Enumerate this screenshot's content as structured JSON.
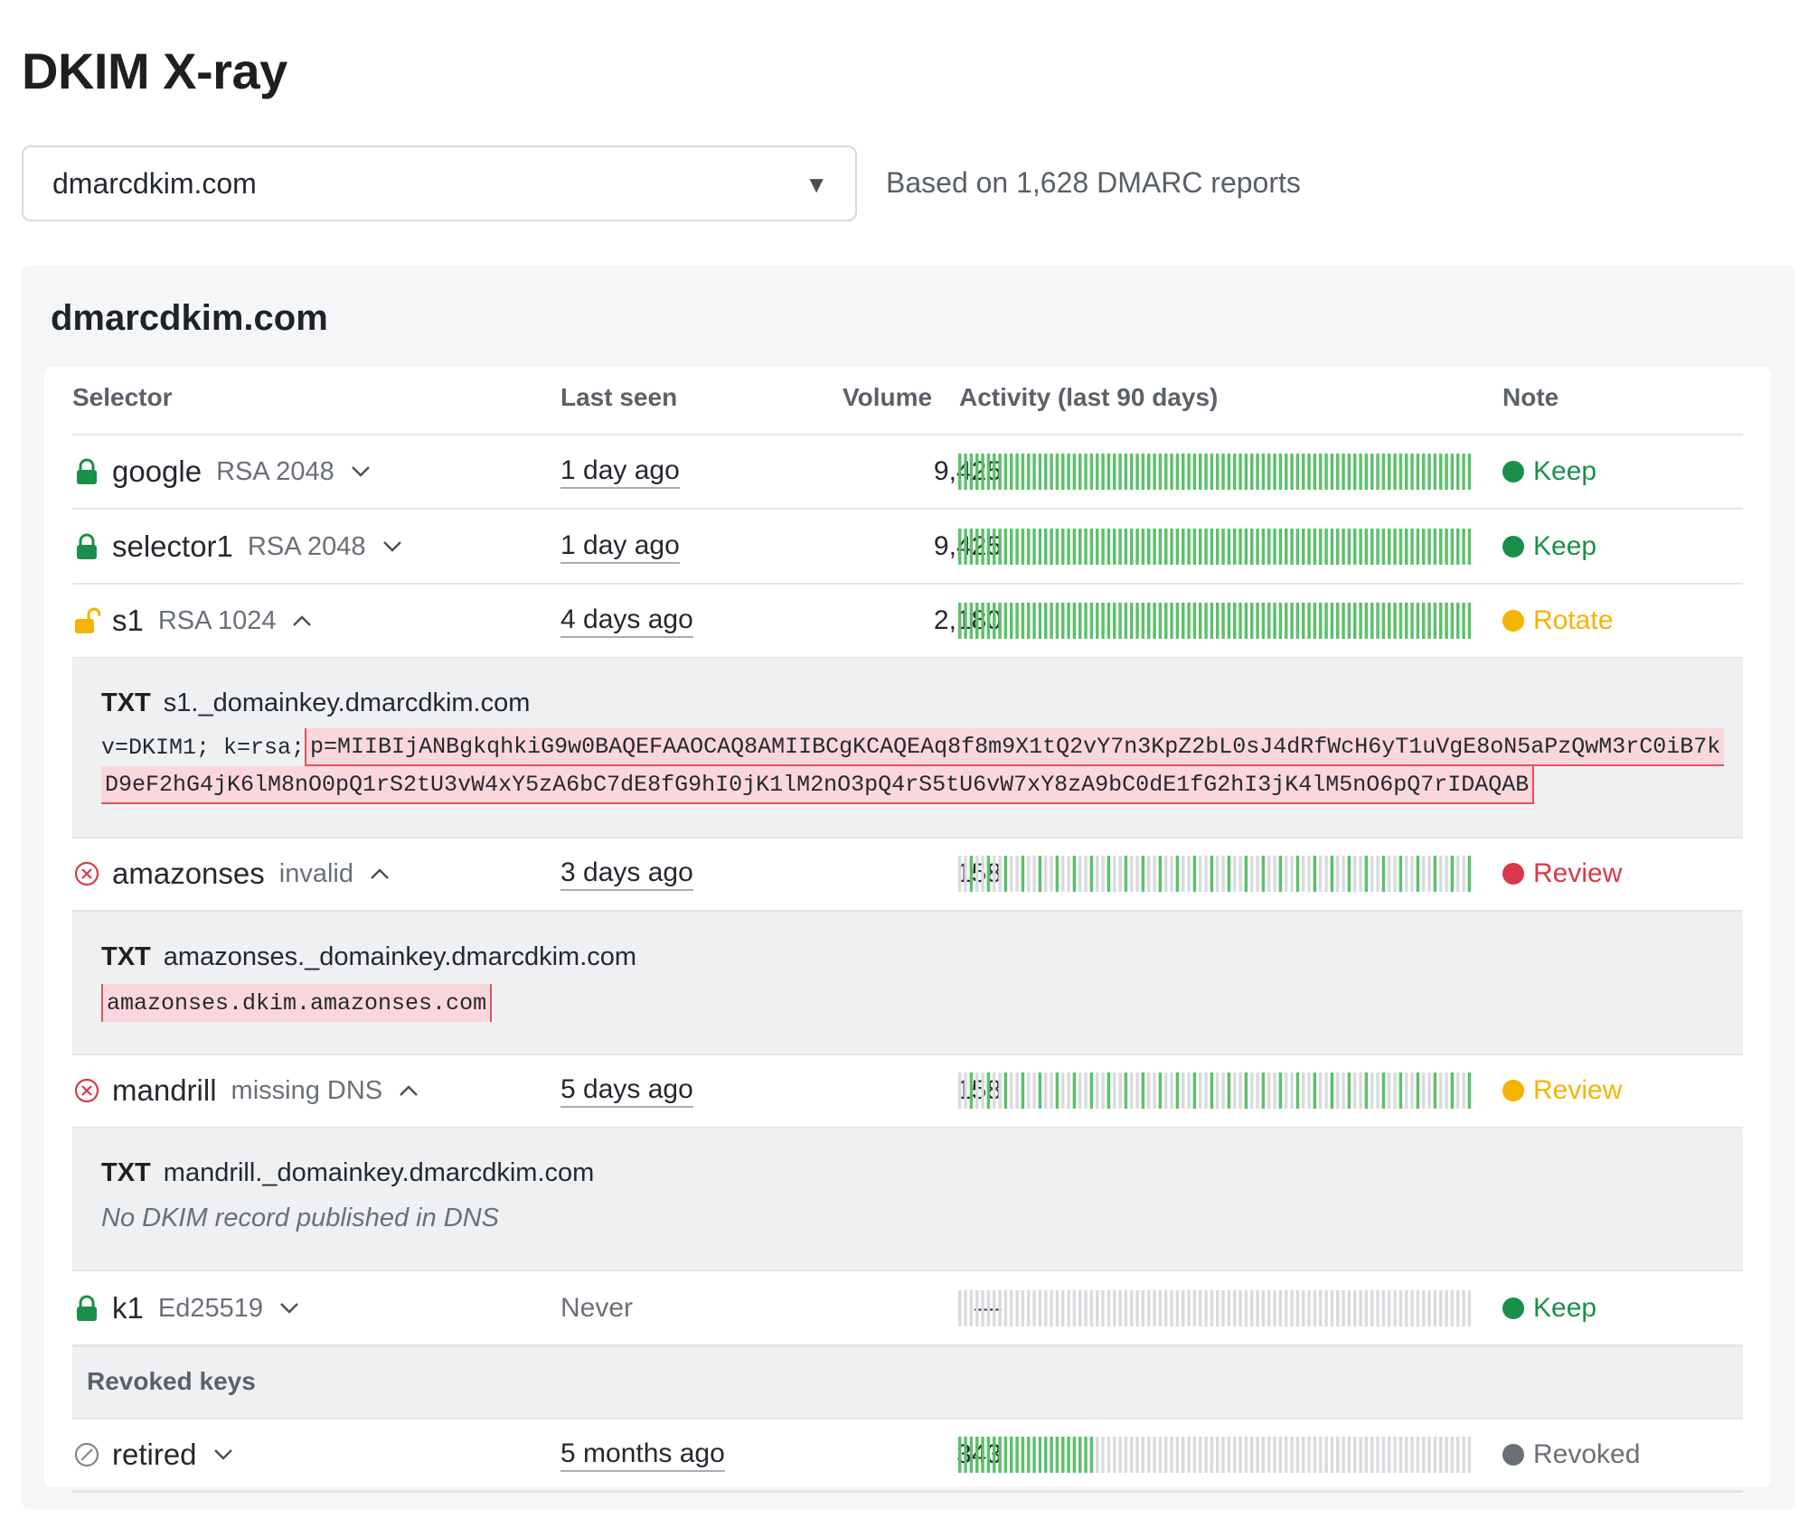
{
  "page": {
    "title": "DKIM X-ray"
  },
  "domain_select": {
    "value": "dmarcdkim.com",
    "caret": "▼"
  },
  "reports_info": "Based on 1,628 DMARC reports",
  "panel": {
    "title": "dmarcdkim.com",
    "columns": {
      "selector": "Selector",
      "last_seen": "Last seen",
      "volume": "Volume",
      "activity": "Activity (last 90 days)",
      "note": "Note"
    },
    "rows": [
      {
        "name": "google",
        "algo": "RSA 2048",
        "chevron": "down",
        "icon": "lock-icon",
        "last_seen": "1 day ago",
        "volume": "9,425",
        "note": "Keep",
        "note_color": "#1a8f4a",
        "activity": {
          "active_fraction": 1.0,
          "pattern": "solid"
        }
      },
      {
        "name": "selector1",
        "algo": "RSA 2048",
        "chevron": "down",
        "icon": "lock-icon",
        "last_seen": "1 day ago",
        "volume": "9,425",
        "note": "Keep",
        "note_color": "#1a8f4a",
        "activity": {
          "active_fraction": 1.0,
          "pattern": "solid"
        }
      },
      {
        "name": "s1",
        "algo": "RSA 1024",
        "chevron": "up",
        "icon": "unlock-icon",
        "last_seen": "4 days ago",
        "volume": "2,180",
        "note": "Rotate",
        "note_color": "#f4b400",
        "activity": {
          "active_fraction": 1.0,
          "pattern": "solid"
        }
      },
      {
        "name": "amazonses",
        "algo": "invalid",
        "chevron": "up",
        "icon": "error-circle-icon",
        "last_seen": "3 days ago",
        "volume": "158",
        "note": "Review",
        "note_color": "#d93848",
        "activity": {
          "active_fraction": 0.33,
          "pattern": "sparse"
        }
      },
      {
        "name": "mandrill",
        "algo": "missing DNS",
        "chevron": "up",
        "icon": "error-circle-icon",
        "last_seen": "5 days ago",
        "volume": "158",
        "note": "Review",
        "note_color": "#f4b400",
        "activity": {
          "active_fraction": 0.33,
          "pattern": "sparse"
        }
      },
      {
        "name": "k1",
        "algo": "Ed25519",
        "chevron": "down",
        "icon": "lock-icon",
        "last_seen": "Never",
        "volume": "—",
        "note": "Keep",
        "note_color": "#1a8f4a",
        "activity": {
          "active_fraction": 0.0,
          "pattern": "none"
        }
      }
    ],
    "details": {
      "s1": {
        "type": "TXT",
        "host": "s1._domainkey.dmarcdkim.com",
        "prefix": "v=DKIM1; k=rsa; ",
        "key_line1": "p=MIIBIjANBgkqhkiG9w0BAQEFAAOCAQ8AMIIBCgKCAQEAq8f8m9X1tQ2vY7n3KpZ2bL0sJ4dRfWcH6yT1uVgE8oN5aPzQwM3rC0iB7k",
        "key_line2": "D9eF2hG4jK6lM8nO0pQ1rS2tU3vW4xY5zA6bC7dE8fG9hI0jK1lM2nO3pQ4rS5tU6vW7xY8zA9bC0dE1fG2hI3jK4lM5nO6pQ7rIDAQAB"
      },
      "amazonses": {
        "type": "TXT",
        "host": "amazonses._domainkey.dmarcdkim.com",
        "record": "amazonses.dkim.amazonses.com"
      },
      "mandrill": {
        "type": "TXT",
        "host": "mandrill._domainkey.dmarcdkim.com",
        "message": "No DKIM record published in DNS"
      }
    },
    "revoked": {
      "label": "Revoked keys",
      "rows": [
        {
          "name": "retired",
          "chevron": "down",
          "icon": "revoked-circle-icon",
          "last_seen": "5 months ago",
          "volume": "343",
          "note": "Revoked",
          "note_color": "#6b7077",
          "activity": {
            "active_fraction": 0.27,
            "pattern": "leading"
          }
        }
      ]
    }
  },
  "colors": {
    "active_bar": "#5cc06b",
    "inactive_bar": "#d9dbde",
    "lock_green": "#1a8f4a",
    "unlock_yellow": "#f4b400",
    "error_red": "#d93848"
  }
}
